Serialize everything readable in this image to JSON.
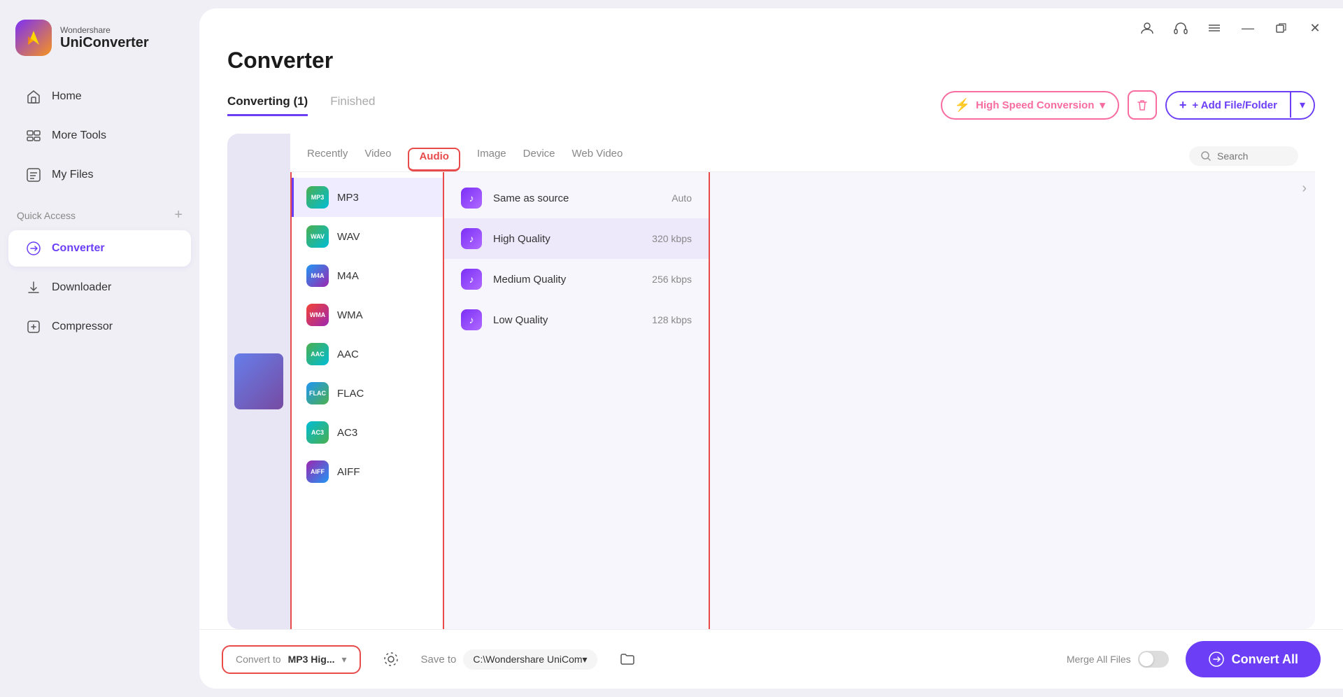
{
  "app": {
    "brand": "Wondershare",
    "name": "UniConverter"
  },
  "titlebar": {
    "buttons": [
      "headphones",
      "menu",
      "minimize",
      "restore",
      "close"
    ]
  },
  "sidebar": {
    "nav_items": [
      {
        "id": "home",
        "label": "Home",
        "icon": "home"
      },
      {
        "id": "more-tools",
        "label": "More Tools",
        "icon": "more-tools"
      },
      {
        "id": "my-files",
        "label": "My Files",
        "icon": "my-files"
      }
    ],
    "quick_access_label": "Quick Access",
    "quick_access_items": [
      {
        "id": "converter",
        "label": "Converter",
        "icon": "converter",
        "active": true
      },
      {
        "id": "downloader",
        "label": "Downloader",
        "icon": "downloader"
      },
      {
        "id": "compressor",
        "label": "Compressor",
        "icon": "compressor"
      }
    ]
  },
  "header": {
    "page_title": "Converter",
    "tabs": [
      {
        "id": "converting",
        "label": "Converting (1)",
        "active": true
      },
      {
        "id": "finished",
        "label": "Finished",
        "active": false
      }
    ],
    "high_speed_label": "High Speed Conversion",
    "delete_tooltip": "Delete",
    "add_file_label": "+ Add File/Folder"
  },
  "format_picker": {
    "tabs": [
      {
        "id": "recently",
        "label": "Recently"
      },
      {
        "id": "video",
        "label": "Video"
      },
      {
        "id": "audio",
        "label": "Audio",
        "active": true
      },
      {
        "id": "image",
        "label": "Image"
      },
      {
        "id": "device",
        "label": "Device"
      },
      {
        "id": "web-video",
        "label": "Web Video"
      }
    ],
    "search_placeholder": "Search",
    "formats": [
      {
        "id": "mp3",
        "label": "MP3",
        "icon_class": "mp3-icon",
        "selected": true
      },
      {
        "id": "wav",
        "label": "WAV",
        "icon_class": "wav-icon"
      },
      {
        "id": "m4a",
        "label": "M4A",
        "icon_class": "m4a-icon"
      },
      {
        "id": "wma",
        "label": "WMA",
        "icon_class": "wma-icon"
      },
      {
        "id": "aac",
        "label": "AAC",
        "icon_class": "aac-icon"
      },
      {
        "id": "flac",
        "label": "FLAC",
        "icon_class": "flac-icon"
      },
      {
        "id": "ac3",
        "label": "AC3",
        "icon_class": "ac3-icon"
      },
      {
        "id": "aiff",
        "label": "AIFF",
        "icon_class": "aiff-icon"
      }
    ],
    "quality_options": [
      {
        "id": "same-as-source",
        "label": "Same as source",
        "value": "Auto"
      },
      {
        "id": "high-quality",
        "label": "High Quality",
        "value": "320 kbps",
        "selected": true
      },
      {
        "id": "medium-quality",
        "label": "Medium Quality",
        "value": "256 kbps"
      },
      {
        "id": "low-quality",
        "label": "Low Quality",
        "value": "128 kbps"
      }
    ]
  },
  "bottom_bar": {
    "convert_to_label": "Convert to",
    "convert_to_value": "MP3 Hig...",
    "save_to_label": "Save to",
    "save_to_path": "C:\\Wondershare UniCom▾",
    "merge_label": "Merge All Files",
    "convert_all_label": "Convert All"
  }
}
